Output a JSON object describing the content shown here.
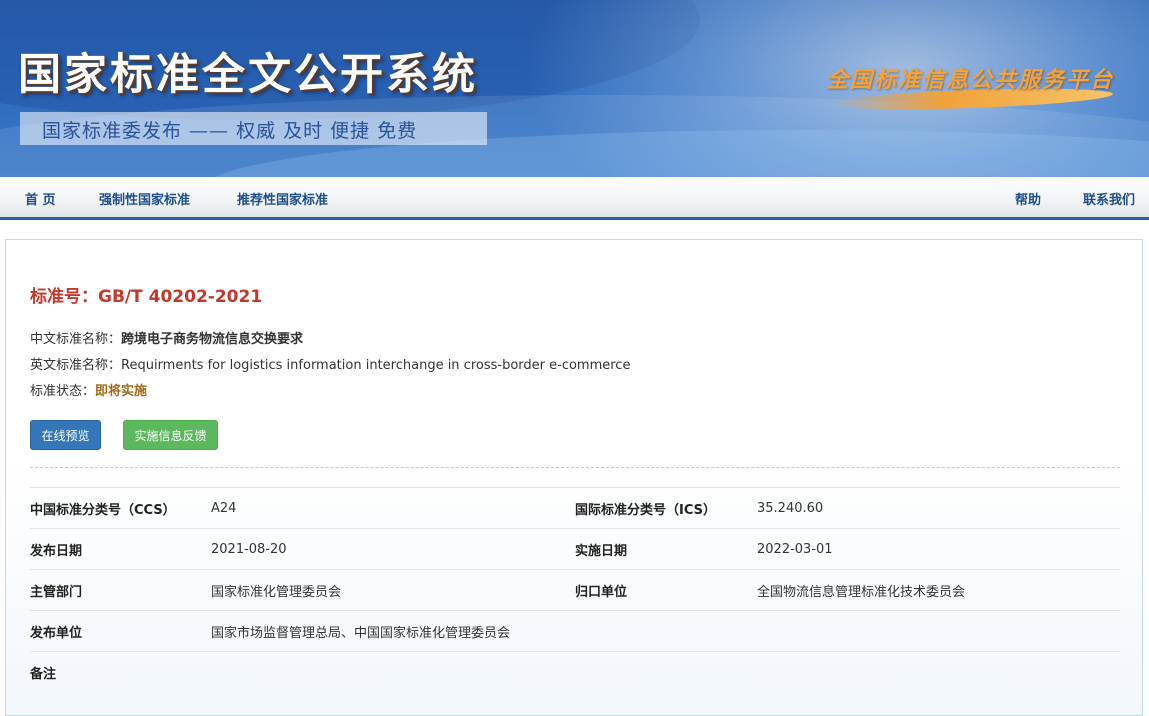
{
  "header": {
    "site_title": "国家标准全文公开系统",
    "slogan": "国家标准委发布 —— 权威 及时 便捷 免费",
    "platform_name": "全国标准信息公共服务平台"
  },
  "nav": {
    "left": [
      "首 页",
      "强制性国家标准",
      "推荐性国家标准"
    ],
    "right": [
      "帮助",
      "联系我们"
    ]
  },
  "standard": {
    "title": "标准号：GB/T 40202-2021",
    "cn_name_label": "中文标准名称：",
    "cn_name": "跨境电子商务物流信息交换要求",
    "en_name_label": "英文标准名称：",
    "en_name": "Requirments for logistics information interchange in cross-border e-commerce",
    "status_label": "标准状态：",
    "status": "即将实施"
  },
  "buttons": {
    "preview": "在线预览",
    "feedback": "实施信息反馈"
  },
  "details": {
    "ccs_label": "中国标准分类号（CCS）",
    "ccs": "A24",
    "ics_label": "国际标准分类号（ICS）",
    "ics": "35.240.60",
    "publish_date_label": "发布日期",
    "publish_date": "2021-08-20",
    "effective_date_label": "实施日期",
    "effective_date": "2022-03-01",
    "dept_label": "主管部门",
    "dept": "国家标准化管理委员会",
    "owner_label": "归口单位",
    "owner": "全国物流信息管理标准化技术委员会",
    "publisher_label": "发布单位",
    "publisher": "国家市场监督管理总局、中国国家标准化管理委员会",
    "remark_label": "备注",
    "remark": ""
  },
  "colors": {
    "banner_blue": "#2f6cbf",
    "nav_text": "#1f4e8c",
    "title_red": "#c0392b",
    "status_brown": "#a06a1a",
    "btn_blue": "#3377b8",
    "btn_green": "#5cb85c"
  }
}
